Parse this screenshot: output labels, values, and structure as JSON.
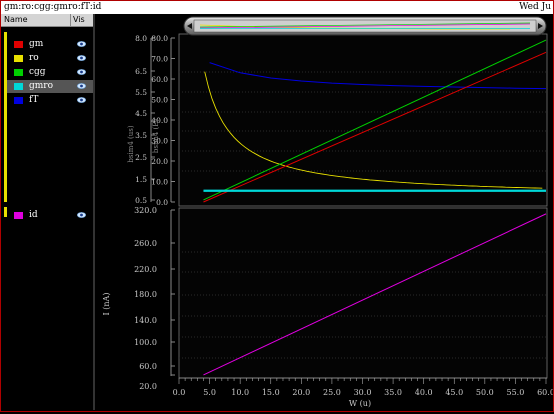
{
  "window": {
    "title": "gm:ro:cgg:gmro:fT:id",
    "date": "Wed Ju"
  },
  "legend": {
    "header": {
      "name": "Name",
      "vis": "Vis"
    },
    "top_items": [
      {
        "label": "gm",
        "color": "#e00000"
      },
      {
        "label": "ro",
        "color": "#e8e000"
      },
      {
        "label": "cgg",
        "color": "#00d000"
      },
      {
        "label": "gmro",
        "color": "#00d8d8",
        "selected": true
      },
      {
        "label": "fT",
        "color": "#0000e0"
      }
    ],
    "bottom_items": [
      {
        "label": "id",
        "color": "#e000e0"
      }
    ],
    "eye_icon": "eye-icon"
  },
  "top_plot": {
    "axis_left_label": "bsim4 (us)",
    "axis_right_label": "bsim4 (E)",
    "left_ticks": [
      "8.0",
      "6.5",
      "5.5",
      "4.5",
      "3.5",
      "2.5",
      "1.5",
      "0.5"
    ],
    "right_ticks": [
      "80.0",
      "70.0",
      "60.0",
      "50.0",
      "40.0",
      "30.0",
      "20.0",
      "10.0",
      "0.0"
    ]
  },
  "bottom_plot": {
    "ylabel": "I (nA)",
    "y_ticks": [
      "320.0",
      "260.0",
      "220.0",
      "180.0",
      "140.0",
      "100.0",
      "60.0",
      "20.0"
    ]
  },
  "x_axis": {
    "label": "W (u)",
    "ticks": [
      "0.0",
      "5.0",
      "10.0",
      "15.0",
      "20.0",
      "25.0",
      "30.0",
      "35.0",
      "40.0",
      "45.0",
      "50.0",
      "55.0",
      "60.0"
    ]
  },
  "chart_data": [
    {
      "type": "line",
      "x": [
        5,
        10,
        15,
        20,
        25,
        30,
        35,
        40,
        45,
        50,
        55,
        60
      ],
      "xlabel": "W (u)",
      "xlim": [
        0,
        60
      ],
      "ylim": [
        0,
        80
      ],
      "series": [
        {
          "name": "gm",
          "color": "#e00000",
          "values": [
            0.5,
            6.5,
            12.5,
            18.5,
            24.5,
            30.5,
            36.5,
            42.5,
            48.5,
            54.5,
            60.5,
            66.5
          ]
        },
        {
          "name": "cgg",
          "color": "#00d000",
          "values": [
            4,
            10,
            16,
            22,
            28,
            34,
            40,
            46,
            52,
            58,
            64,
            78
          ]
        },
        {
          "name": "gmro",
          "color": "#00d8d8",
          "values": [
            5.5,
            5.5,
            5.5,
            5.5,
            5.5,
            5.5,
            5.5,
            5.5,
            5.5,
            5.5,
            5.5,
            5.5
          ]
        },
        {
          "name": "ro",
          "color": "#e8e000",
          "values": [
            72,
            34,
            20,
            13,
            9.5,
            7.5,
            6,
            5,
            4.3,
            3.8,
            3.3,
            2.8
          ]
        },
        {
          "name": "fT",
          "color": "#0000e0",
          "values": [
            68,
            63,
            60.5,
            59,
            58,
            57.3,
            56.8,
            56.4,
            56.1,
            55.8,
            55.5,
            55.3
          ]
        }
      ]
    },
    {
      "type": "line",
      "x": [
        4,
        60
      ],
      "xlabel": "W (u)",
      "ylabel": "I (nA)",
      "xlim": [
        0,
        60
      ],
      "ylim": [
        20,
        320
      ],
      "series": [
        {
          "name": "id",
          "color": "#e000e0",
          "values": [
            22,
            313
          ]
        }
      ]
    }
  ]
}
